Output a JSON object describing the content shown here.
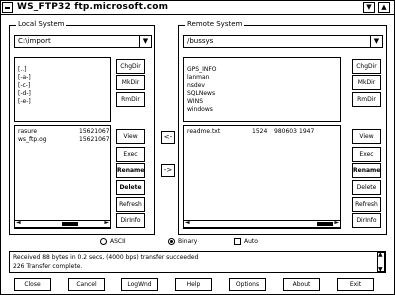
{
  "window": {
    "title": "WS_FTP32 ftp.microsoft.com",
    "min_icon": "minimize-arrow",
    "max_icon": "maximize-arrow"
  },
  "local": {
    "label": "Local System",
    "path": "C:\\import",
    "dirs": [
      "[..]",
      "[-a-]",
      "[-c-]",
      "[-d-]",
      "[-e-]"
    ],
    "files": [
      {
        "name": "rasure",
        "size": "15621067"
      },
      {
        "name": "ws_ftp.og",
        "size": "15621067"
      }
    ],
    "buttons": [
      "ChgDir",
      "MkDir",
      "RmDir",
      "View",
      "Exec",
      "Rename",
      "Delete",
      "Refresh",
      "DirInfo"
    ]
  },
  "remote": {
    "label": "Remote System",
    "path": "/bussys",
    "dirs": [
      "GPS_INFO",
      "lanman",
      "nsdev",
      "SQLNews",
      "WINS",
      "windows"
    ],
    "files": [
      {
        "name": "readme.txt",
        "size": "1524",
        "date": "980603",
        "time": "1947"
      }
    ],
    "buttons": [
      "ChgDir",
      "MkDir",
      "RmDir",
      "View",
      "Exec",
      "Rename",
      "Delete",
      "Refresh",
      "DirInfo"
    ]
  },
  "transfer": {
    "left": "<-",
    "right": "->"
  },
  "mode": {
    "ascii": "ASCII",
    "binary": "Binary",
    "auto": "Auto",
    "selected": "binary"
  },
  "status": {
    "lines": [
      "Received 88 bytes in 0.2 secs, (4000 bps) transfer succeeded",
      "226 Transfer complete."
    ]
  },
  "bottom_buttons": [
    "Close",
    "Cancel",
    "LogWnd",
    "Help",
    "Options",
    "About",
    "Exit"
  ]
}
